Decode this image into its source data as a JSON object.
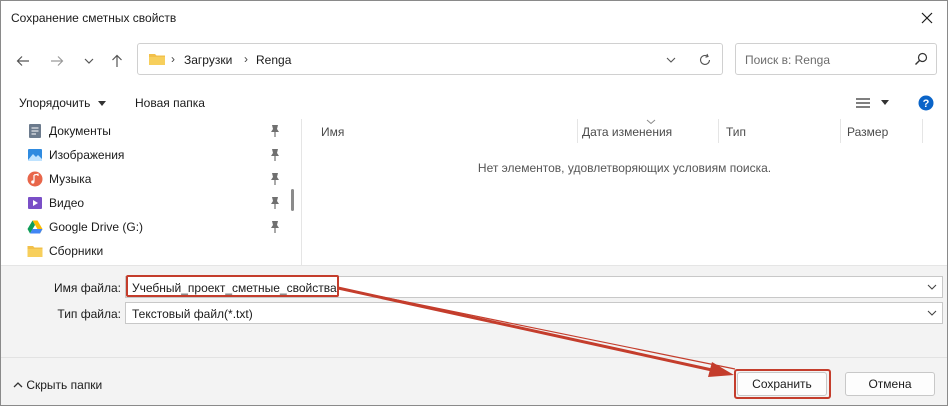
{
  "window": {
    "title": "Сохранение сметных свойств"
  },
  "address": {
    "segments": [
      "Загрузки",
      "Renga"
    ],
    "separator": "›"
  },
  "search": {
    "placeholder": "Поиск в: Renga"
  },
  "toolbar": {
    "organize_label": "Упорядочить",
    "new_folder_label": "Новая папка"
  },
  "navpane": {
    "items": [
      {
        "label": "Документы",
        "icon": "documents-icon",
        "pinned": true
      },
      {
        "label": "Изображения",
        "icon": "pictures-icon",
        "pinned": true
      },
      {
        "label": "Музыка",
        "icon": "music-icon",
        "pinned": true
      },
      {
        "label": "Видео",
        "icon": "video-icon",
        "pinned": true
      },
      {
        "label": "Google Drive (G:)",
        "icon": "google-drive-icon",
        "pinned": true
      },
      {
        "label": "Сборники",
        "icon": "folder-icon",
        "pinned": false
      }
    ]
  },
  "filelist": {
    "columns": [
      "Имя",
      "Дата изменения",
      "Тип",
      "Размер"
    ],
    "empty_message": "Нет элементов, удовлетворяющих условиям поиска."
  },
  "form": {
    "filename_label": "Имя файла:",
    "filename_value": "Учебный_проект_сметные_свойства",
    "filetype_label": "Тип файла:",
    "filetype_value": "Текстовый файл(*.txt)"
  },
  "footer": {
    "hide_folders_label": "Скрыть папки",
    "save_label": "Сохранить",
    "cancel_label": "Отмена"
  },
  "colors": {
    "annotation": "#c43d2c",
    "help": "#0a64c8",
    "folder": "#f2c04a"
  }
}
